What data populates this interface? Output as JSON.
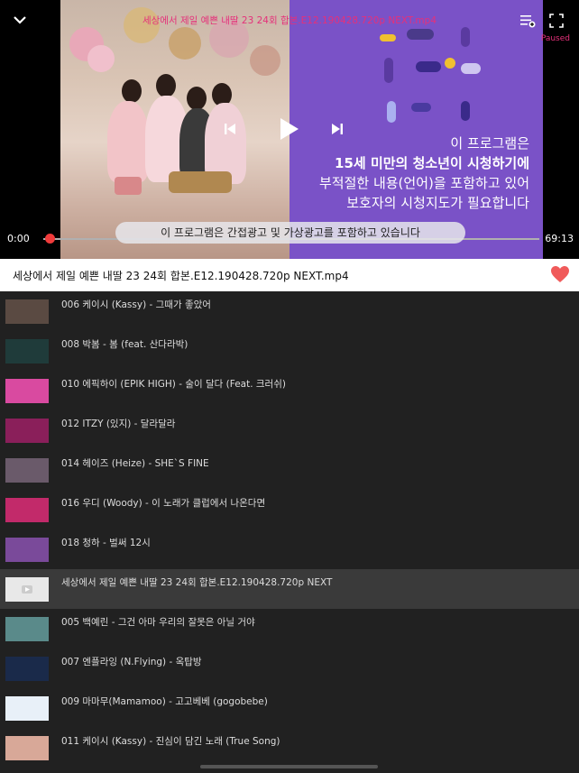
{
  "player": {
    "overlay_title": "세상에서 제일 예쁜 내딸 23 24회 합본.E12.190428.720p NEXT.mp4",
    "status": "Paused",
    "time_current": "0:00",
    "time_total": "69:13",
    "notice": "이 프로그램은 간접광고 및 가상광고를 포함하고 있습니다",
    "rating_lines": [
      "이 프로그램은",
      "15세 미만의 청소년이 시청하기에",
      "부적절한 내용(언어)을 포함하고 있어",
      "보호자의 시청지도가 필요합니다"
    ]
  },
  "now_playing": {
    "title": "세상에서 제일 예쁜 내딸 23 24회 합본.E12.190428.720p NEXT.mp4",
    "favorite": true,
    "heart_color": "#f05a5a"
  },
  "playlist": [
    {
      "label": "006 케이시 (Kassy) - 그때가 좋았어",
      "thumb": "#5a4a42"
    },
    {
      "label": "008 박봄 - 봄 (feat. 산다라박)",
      "thumb": "#1f3b3a"
    },
    {
      "label": "010 에픽하이 (EPIK HIGH) - 술이 달다 (Feat. 크러쉬)",
      "thumb": "#d94aa0"
    },
    {
      "label": "012 ITZY (있지) - 달라달라",
      "thumb": "#8a1f5a"
    },
    {
      "label": "014 헤이즈 (Heize) - SHE`S FINE",
      "thumb": "#6a5a6a"
    },
    {
      "label": "016 우디 (Woody) - 이 노래가 클럽에서 나온다면",
      "thumb": "#c22a6a"
    },
    {
      "label": "018 청하 - 벌써 12시",
      "thumb": "#7a4a9a"
    },
    {
      "label": "세상에서 제일 예쁜 내딸 23 24회 합본.E12.190428.720p NEXT",
      "thumb": "#e8e8e8",
      "active": true
    },
    {
      "label": "005 백예린 - 그건 아마 우리의 잘못은 아닐 거야",
      "thumb": "#5a8a8a"
    },
    {
      "label": "007 엔플라잉 (N.Flying) - 옥탑방",
      "thumb": "#1a2a4a"
    },
    {
      "label": "009 마마무(Mamamoo) - 고고베베 (gogobebe)",
      "thumb": "#e8f0f8"
    },
    {
      "label": "011 케이시 (Kassy) - 진심이 담긴 노래 (True Song)",
      "thumb": "#d8a898"
    }
  ]
}
